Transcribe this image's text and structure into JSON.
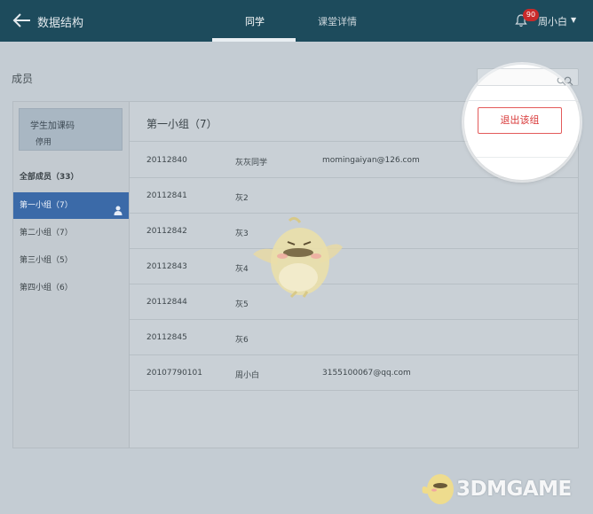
{
  "header": {
    "course_title": "数据结构",
    "tabs": [
      {
        "label": "同学",
        "active": true
      },
      {
        "label": "课堂详情",
        "active": false
      }
    ],
    "notification_count": "90",
    "user_name": "周小白",
    "user_menu_caret": "▼"
  },
  "section": {
    "title": "成员",
    "search_placeholder": ""
  },
  "sidebar": {
    "course_code_title": "学生加课码",
    "course_code_status": "停用",
    "items": [
      {
        "label": "全部成员（33）"
      },
      {
        "label": "第一小组（7）",
        "selected": true
      },
      {
        "label": "第二小组（7）"
      },
      {
        "label": "第三小组（5）"
      },
      {
        "label": "第四小组（6）"
      }
    ]
  },
  "group": {
    "title": "第一小组（7）",
    "exit_button_label": "退出该组",
    "members": [
      {
        "id": "20112840",
        "name": "灰灰同学",
        "email": "momingaiyan@126.com"
      },
      {
        "id": "20112841",
        "name": "灰2",
        "email": ""
      },
      {
        "id": "20112842",
        "name": "灰3",
        "email": ""
      },
      {
        "id": "20112843",
        "name": "灰4",
        "email": ""
      },
      {
        "id": "20112844",
        "name": "灰5",
        "email": ""
      },
      {
        "id": "20112845",
        "name": "灰6",
        "email": ""
      },
      {
        "id": "20107790101",
        "name": "周小白",
        "email": "3155100067@qq.com"
      }
    ]
  },
  "watermark": {
    "text": "3DMGAME"
  },
  "colors": {
    "topbar": "#1d4b5c",
    "selected_item": "#3b6aa8",
    "badge": "#c92a2a",
    "exit_button": "#d93a3a"
  },
  "icons": [
    "back-arrow-icon",
    "bell-icon",
    "search-icon",
    "person-icon",
    "mascot-icon"
  ]
}
